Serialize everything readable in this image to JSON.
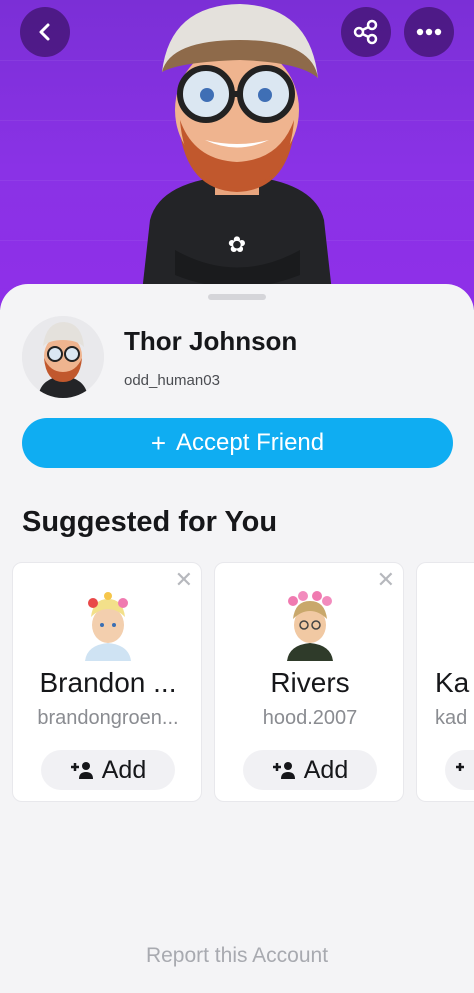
{
  "colors": {
    "hero": "#8a32e6",
    "accent": "#0fadf2",
    "background": "#f4f4f6"
  },
  "header": {
    "back_icon": "chevron-left-icon",
    "share_icon": "share-icon",
    "more_icon": "more-dots-icon"
  },
  "profile": {
    "display_name": "Thor Johnson",
    "username": "odd_human03"
  },
  "accept_button": {
    "plus": "+",
    "label": "Accept Friend"
  },
  "suggested": {
    "title": "Suggested for You",
    "cards": [
      {
        "name": "Brandon ...",
        "username": "brandongroen...",
        "add_label": "Add"
      },
      {
        "name": "Rivers",
        "username": "hood.2007",
        "add_label": "Add"
      },
      {
        "name": "Ka",
        "username": "kad",
        "add_label": "Add"
      }
    ],
    "close_symbol": "✕"
  },
  "footer": {
    "report_link": "Report this Account"
  }
}
